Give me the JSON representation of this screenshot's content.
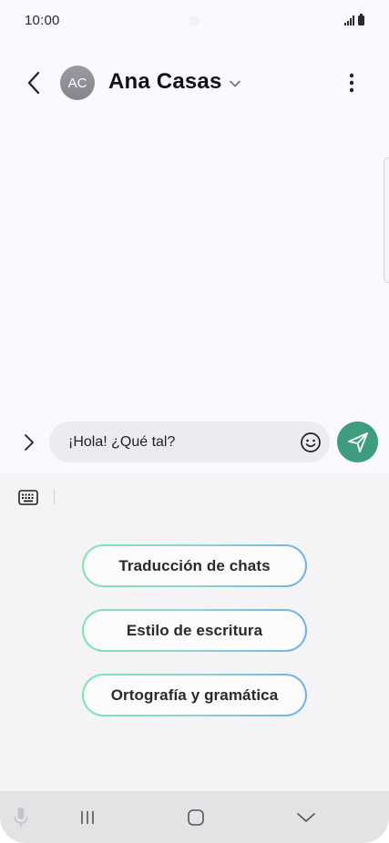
{
  "status_bar": {
    "time": "10:00",
    "icons": [
      "signal-icon",
      "battery-icon"
    ]
  },
  "header": {
    "avatar_initials": "AC",
    "contact_name": "Ana Casas",
    "icons": [
      "back-arrow-icon",
      "chevron-down-icon",
      "more-vertical-icon"
    ]
  },
  "composer": {
    "message_value": "¡Hola! ¿Qué tal?",
    "icons": [
      "expand-chevron-icon",
      "emoji-icon",
      "send-icon"
    ],
    "send_button_color": "#3f9c7f"
  },
  "ai_panel": {
    "options": [
      {
        "label": "Traducción de chats"
      },
      {
        "label": "Estilo de escritura"
      },
      {
        "label": "Ortografía y gramática"
      }
    ],
    "icons": [
      "keyboard-icon"
    ],
    "option_border_gradient": [
      "#7de3b2",
      "#6fb2ea"
    ]
  },
  "nav_bar": {
    "icons": [
      "microphone-icon",
      "recents-icon",
      "home-icon",
      "hide-keyboard-icon"
    ]
  },
  "colors": {
    "background": "#fafafe",
    "panel_background": "#f4f4f6",
    "avatar": "#8e8e96"
  }
}
